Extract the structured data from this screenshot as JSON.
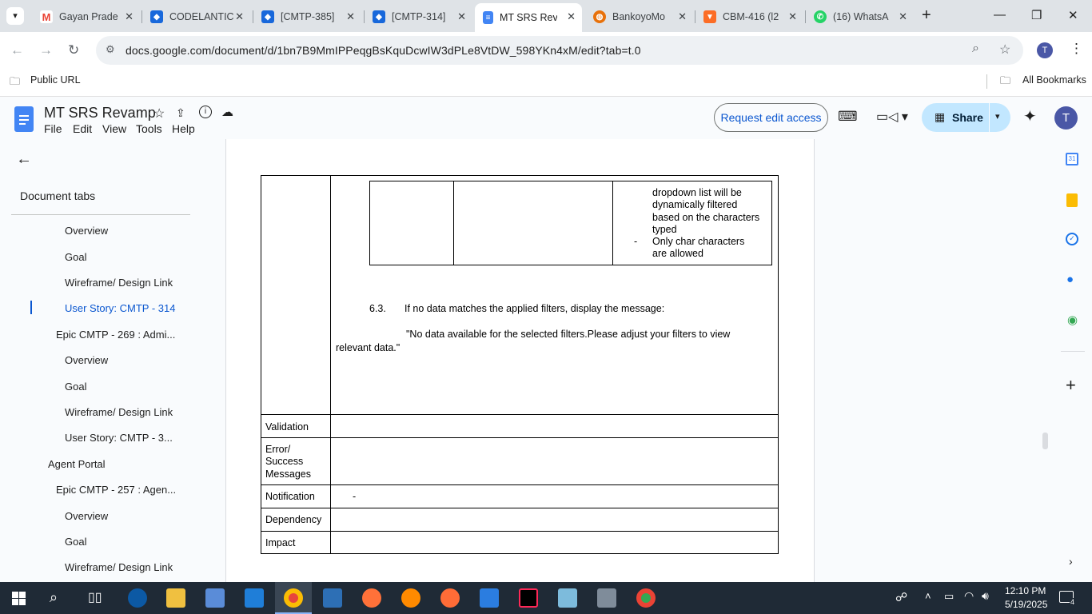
{
  "browser": {
    "tabs": [
      {
        "title": "Gayan Prade",
        "favicon": "gmail-icon"
      },
      {
        "title": "CODELANTIC",
        "favicon": "jira-icon"
      },
      {
        "title": "[CMTP-385]",
        "favicon": "jira-icon"
      },
      {
        "title": "[CMTP-314]",
        "favicon": "jira-icon"
      },
      {
        "title": "MT SRS Reva",
        "favicon": "docs-icon",
        "active": true
      },
      {
        "title": "BankoyoMo",
        "favicon": "globe-icon"
      },
      {
        "title": "CBM-416 (l2",
        "favicon": "gitlab-icon"
      },
      {
        "title": "(16) WhatsA",
        "favicon": "whatsapp-icon"
      }
    ],
    "url": "docs.google.com/document/d/1bn7B9MmIPPeqgBsKquDcwIW3dPLe8VtDW_598YKn4xM/edit?tab=t.0",
    "profile_initial": "T",
    "bookmarks": {
      "left": "Public URL",
      "right": "All Bookmarks"
    }
  },
  "docs": {
    "title": "MT SRS Revamp",
    "menu": [
      "File",
      "Edit",
      "View",
      "Tools",
      "Help"
    ],
    "request_edit": "Request edit access",
    "share": "Share",
    "avatar": "T"
  },
  "left_panel": {
    "heading": "Document tabs",
    "items": [
      {
        "label": "Overview",
        "level": 3
      },
      {
        "label": "Goal",
        "level": 3
      },
      {
        "label": "Wireframe/ Design Link",
        "level": 3
      },
      {
        "label": "User Story: CMTP - 314",
        "level": 3,
        "active": true
      },
      {
        "label": "Epic CMTP - 269 : Admi...",
        "level": 2
      },
      {
        "label": "Overview",
        "level": 3
      },
      {
        "label": "Goal",
        "level": 3
      },
      {
        "label": "Wireframe/ Design Link",
        "level": 3
      },
      {
        "label": "User Story: CMTP - 3...",
        "level": 3
      },
      {
        "label": "Agent Portal",
        "level": 1
      },
      {
        "label": "Epic CMTP - 257 : Agen...",
        "level": 2
      },
      {
        "label": "Overview",
        "level": 3
      },
      {
        "label": "Goal",
        "level": 3
      },
      {
        "label": "Wireframe/ Design Link",
        "level": 3
      }
    ]
  },
  "document": {
    "inner_cell_lines": [
      "dropdown list will be",
      "dynamically filtered",
      "based on the characters",
      "typed"
    ],
    "inner_bullet": "-",
    "inner_bullet_lines": [
      "Only char characters",
      "are allowed"
    ],
    "item_number": "6.3.",
    "item_text": "If no data matches the applied filters, display the message:",
    "quote_line1": "\"No data available for the selected filters.Please adjust your filters to view",
    "quote_line2": "relevant data.\"",
    "rows": [
      {
        "label": "Validation",
        "value": ""
      },
      {
        "label_lines": [
          "Error/",
          "Success",
          "Messages"
        ],
        "value": ""
      },
      {
        "label": "Notification",
        "value": "-"
      },
      {
        "label": "Dependency",
        "value": ""
      },
      {
        "label": "Impact",
        "value": ""
      }
    ]
  },
  "taskbar": {
    "time": "12:10 PM",
    "date": "5/19/2025",
    "notifications": "4"
  }
}
